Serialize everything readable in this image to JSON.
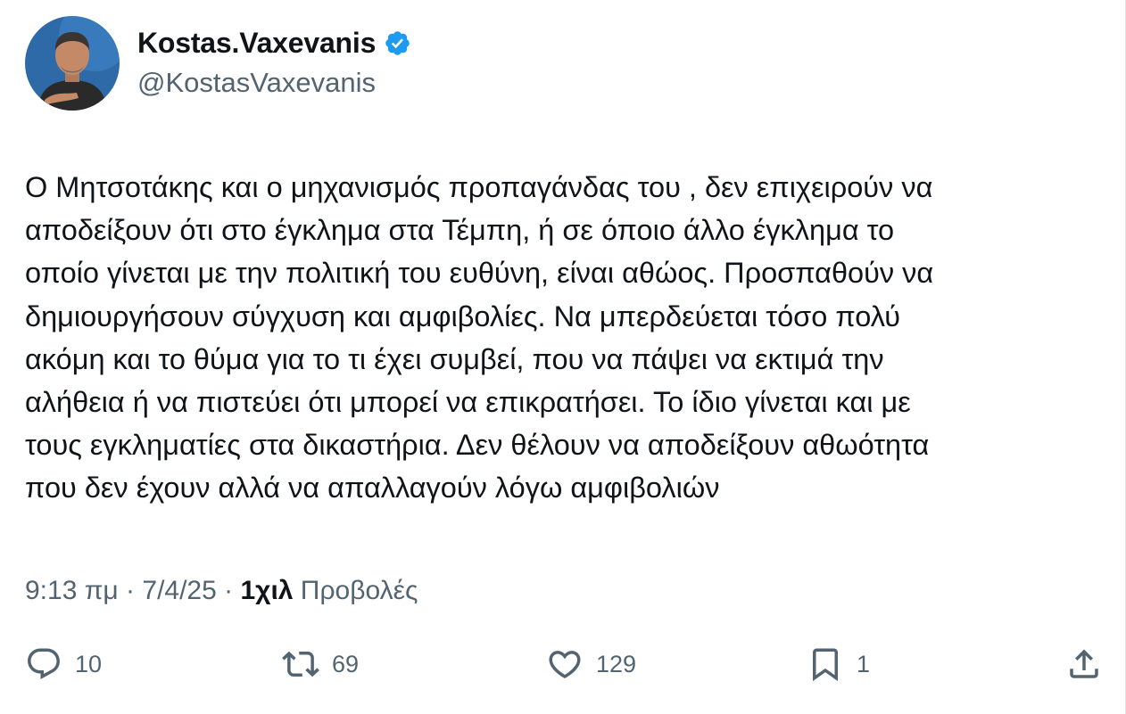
{
  "author": {
    "display_name": "Kostas.Vaxevanis",
    "handle": "@KostasVaxevanis",
    "verified": true,
    "verified_color": "#1d9bf0"
  },
  "tweet": {
    "text": "Ο Μητσοτάκης και ο μηχανισμός προπαγάνδας του , δεν επιχειρούν να\nαποδείξουν ότι στο έγκλημα στα Τέμπη, ή σε όποιο άλλο έγκλημα το\nοποίο γίνεται με την πολιτική του ευθύνη, είναι αθώος. Προσπαθούν να\nδημιουργήσουν σύγχυση και αμφιβολίες. Να μπερδεύεται τόσο πολύ\nακόμη και το θύμα για το τι έχει συμβεί, που να πάψει να εκτιμά την\nαλήθεια ή να πιστεύει ότι μπορεί να επικρατήσει. Το ίδιο γίνεται και με\nτους εγκληματίες στα δικαστήρια. Δεν θέλουν να αποδείξουν αθωότητα\nπου δεν έχουν αλλά να απαλλαγούν λόγω αμφιβολιών"
  },
  "meta": {
    "time": "9:13 πμ",
    "separator": " · ",
    "date": "7/4/25",
    "views_count": "1χιλ",
    "views_label": " Προβολές"
  },
  "actions": {
    "reply": {
      "icon": "reply-icon",
      "count": "10"
    },
    "retweet": {
      "icon": "retweet-icon",
      "count": "69"
    },
    "like": {
      "icon": "heart-icon",
      "count": "129"
    },
    "bookmark": {
      "icon": "bookmark-icon",
      "count": "1"
    },
    "share": {
      "icon": "share-icon"
    }
  },
  "colors": {
    "text_primary": "#0f1419",
    "text_secondary": "#536471",
    "accent": "#1d9bf0"
  }
}
